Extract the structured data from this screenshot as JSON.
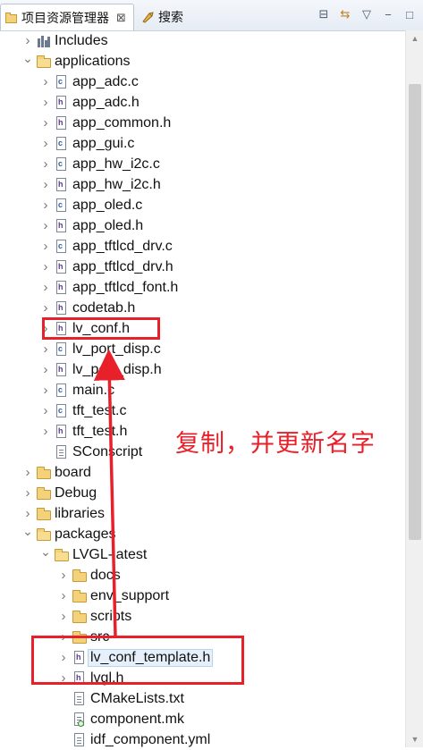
{
  "tabs": {
    "project_explorer": "项目资源管理器",
    "project_explorer_close": "⊠",
    "search": "搜索"
  },
  "toolbar": {
    "collapse_all": "⊟",
    "link_editor": "⇆",
    "view_menu": "▽",
    "minimize": "−",
    "maximize": "□"
  },
  "tree": {
    "rows": [
      {
        "label": "Includes",
        "kind": "lib",
        "twisty": "collapsed",
        "depth": 0
      },
      {
        "label": "applications",
        "kind": "folder-open",
        "twisty": "expanded",
        "depth": 0
      },
      {
        "label": "app_adc.c",
        "kind": "c",
        "twisty": "collapsed",
        "depth": 1
      },
      {
        "label": "app_adc.h",
        "kind": "h",
        "twisty": "collapsed",
        "depth": 1
      },
      {
        "label": "app_common.h",
        "kind": "h",
        "twisty": "collapsed",
        "depth": 1
      },
      {
        "label": "app_gui.c",
        "kind": "c",
        "twisty": "collapsed",
        "depth": 1
      },
      {
        "label": "app_hw_i2c.c",
        "kind": "c",
        "twisty": "collapsed",
        "depth": 1
      },
      {
        "label": "app_hw_i2c.h",
        "kind": "h",
        "twisty": "collapsed",
        "depth": 1
      },
      {
        "label": "app_oled.c",
        "kind": "c",
        "twisty": "collapsed",
        "depth": 1
      },
      {
        "label": "app_oled.h",
        "kind": "h",
        "twisty": "collapsed",
        "depth": 1
      },
      {
        "label": "app_tftlcd_drv.c",
        "kind": "c",
        "twisty": "collapsed",
        "depth": 1
      },
      {
        "label": "app_tftlcd_drv.h",
        "kind": "h",
        "twisty": "collapsed",
        "depth": 1
      },
      {
        "label": "app_tftlcd_font.h",
        "kind": "h",
        "twisty": "collapsed",
        "depth": 1
      },
      {
        "label": "codetab.h",
        "kind": "h",
        "twisty": "collapsed",
        "depth": 1
      },
      {
        "label": "lv_conf.h",
        "kind": "h",
        "twisty": "collapsed",
        "depth": 1
      },
      {
        "label": "lv_port_disp.c",
        "kind": "c",
        "twisty": "collapsed",
        "depth": 1
      },
      {
        "label": "lv_port_disp.h",
        "kind": "h",
        "twisty": "collapsed",
        "depth": 1
      },
      {
        "label": "main.c",
        "kind": "c",
        "twisty": "collapsed",
        "depth": 1
      },
      {
        "label": "tft_test.c",
        "kind": "c",
        "twisty": "collapsed",
        "depth": 1
      },
      {
        "label": "tft_test.h",
        "kind": "h",
        "twisty": "collapsed",
        "depth": 1
      },
      {
        "label": "SConscript",
        "kind": "text",
        "twisty": "none",
        "depth": 1
      },
      {
        "label": "board",
        "kind": "folder",
        "twisty": "collapsed",
        "depth": 0
      },
      {
        "label": "Debug",
        "kind": "folder",
        "twisty": "collapsed",
        "depth": 0
      },
      {
        "label": "libraries",
        "kind": "folder",
        "twisty": "collapsed",
        "depth": 0
      },
      {
        "label": "packages",
        "kind": "folder-open",
        "twisty": "expanded",
        "depth": 0
      },
      {
        "label": "LVGL-latest",
        "kind": "folder-open",
        "twisty": "expanded",
        "depth": 1
      },
      {
        "label": "docs",
        "kind": "folder",
        "twisty": "collapsed",
        "depth": 2
      },
      {
        "label": "env_support",
        "kind": "folder",
        "twisty": "collapsed",
        "depth": 2
      },
      {
        "label": "scripts",
        "kind": "folder",
        "twisty": "collapsed",
        "depth": 2
      },
      {
        "label": "src",
        "kind": "folder",
        "twisty": "collapsed",
        "depth": 2
      },
      {
        "label": "lv_conf_template.h",
        "kind": "h",
        "twisty": "collapsed",
        "depth": 2,
        "selected": true
      },
      {
        "label": "lvgl.h",
        "kind": "h",
        "twisty": "collapsed",
        "depth": 2
      },
      {
        "label": "CMakeLists.txt",
        "kind": "text",
        "twisty": "none",
        "depth": 2
      },
      {
        "label": "component.mk",
        "kind": "mk",
        "twisty": "none",
        "depth": 2
      },
      {
        "label": "idf_component.yml",
        "kind": "text",
        "twisty": "none",
        "depth": 2
      }
    ]
  },
  "annotation": {
    "text": "复制，并更新名字",
    "color": "#e8202a"
  }
}
